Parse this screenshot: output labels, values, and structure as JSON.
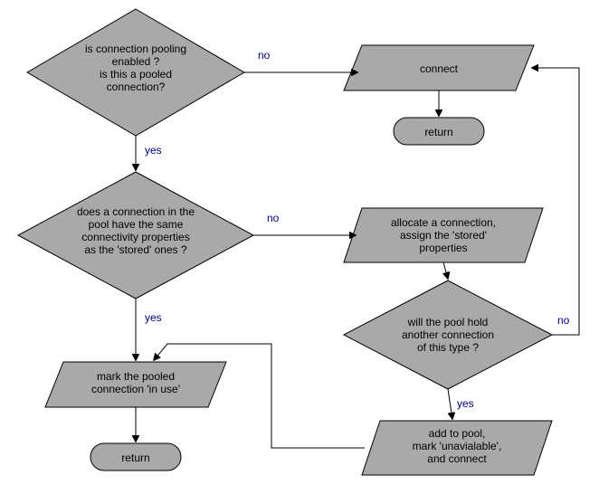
{
  "nodes": {
    "d1": {
      "l1": "is connection pooling",
      "l2": "enabled ?",
      "l3": "is this a pooled",
      "l4": "connection?"
    },
    "p_connect": {
      "l1": "connect"
    },
    "t_return1": {
      "l1": "return"
    },
    "d2": {
      "l1": "does a connection in the",
      "l2": "pool have the same",
      "l3": "connectivity properties",
      "l4": "as the 'stored' ones ?"
    },
    "p_alloc": {
      "l1": "allocate a connection,",
      "l2": "assign the 'stored'",
      "l3": "properties"
    },
    "d3": {
      "l1": "will the pool hold",
      "l2": "another connection",
      "l3": "of this type ?"
    },
    "p_mark": {
      "l1": "mark the pooled",
      "l2": "connection 'in use'"
    },
    "t_return2": {
      "l1": "return"
    },
    "p_add": {
      "l1": "add to pool,",
      "l2": "mark 'unavialable',",
      "l3": "and connect"
    }
  },
  "labels": {
    "d1_no": "no",
    "d1_yes": "yes",
    "d2_no": "no",
    "d2_yes": "yes",
    "d3_no": "no",
    "d3_yes": "yes"
  },
  "chart_data": {
    "type": "flowchart",
    "nodes": [
      {
        "id": "d1",
        "type": "decision",
        "text": "is connection pooling enabled ? is this a pooled connection?"
      },
      {
        "id": "p_connect",
        "type": "process",
        "text": "connect"
      },
      {
        "id": "t_return1",
        "type": "terminator",
        "text": "return"
      },
      {
        "id": "d2",
        "type": "decision",
        "text": "does a connection in the pool have the same connectivity properties as the 'stored' ones ?"
      },
      {
        "id": "p_alloc",
        "type": "process",
        "text": "allocate a connection, assign the 'stored' properties"
      },
      {
        "id": "d3",
        "type": "decision",
        "text": "will the pool hold another connection of this type ?"
      },
      {
        "id": "p_mark",
        "type": "process",
        "text": "mark the pooled connection 'in use'"
      },
      {
        "id": "t_return2",
        "type": "terminator",
        "text": "return"
      },
      {
        "id": "p_add",
        "type": "process",
        "text": "add to pool, mark 'unavialable', and connect"
      }
    ],
    "edges": [
      {
        "from": "d1",
        "to": "p_connect",
        "label": "no"
      },
      {
        "from": "p_connect",
        "to": "t_return1"
      },
      {
        "from": "d1",
        "to": "d2",
        "label": "yes"
      },
      {
        "from": "d2",
        "to": "p_alloc",
        "label": "no"
      },
      {
        "from": "d2",
        "to": "p_mark",
        "label": "yes"
      },
      {
        "from": "p_mark",
        "to": "t_return2"
      },
      {
        "from": "p_alloc",
        "to": "d3"
      },
      {
        "from": "d3",
        "to": "p_connect",
        "label": "no"
      },
      {
        "from": "d3",
        "to": "p_add",
        "label": "yes"
      },
      {
        "from": "p_add",
        "to": "p_mark"
      }
    ]
  }
}
